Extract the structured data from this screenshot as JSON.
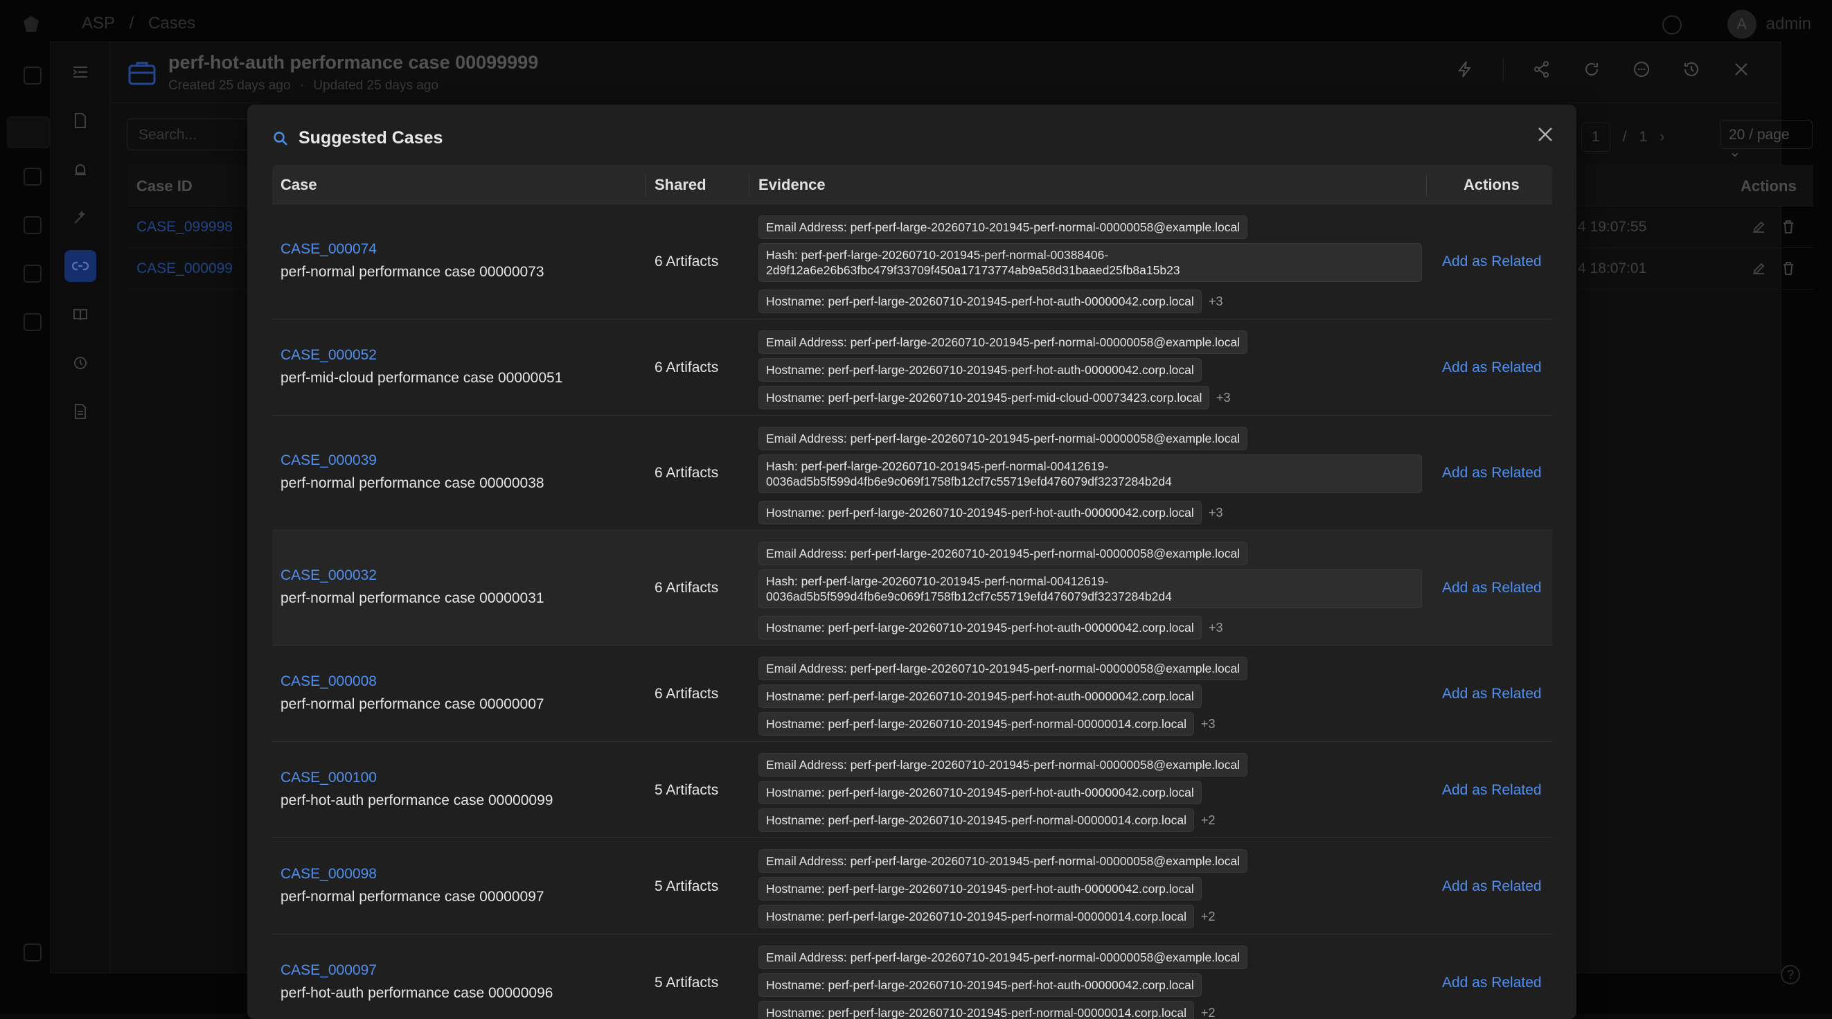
{
  "app": {
    "breadcrumb": [
      "ASP",
      "/",
      "Cases"
    ],
    "user": {
      "avatar": "A",
      "name": "admin"
    }
  },
  "drawer": {
    "title": "perf-hot-auth performance case 00099999",
    "created": "Created 25 days ago",
    "updated": "Updated 25 days ago",
    "meta_sep": "·",
    "search_placeholder": "Search...",
    "pager": {
      "current": "1",
      "sep": "/",
      "total": "1",
      "page_size": "20 / page"
    },
    "table": {
      "col_case_id": "Case ID",
      "col_actions": "Actions",
      "rows": [
        {
          "id": "CASE_099998",
          "time": "4 19:07:55"
        },
        {
          "id": "CASE_000099",
          "time": "4 18:07:01"
        }
      ]
    }
  },
  "modal": {
    "title": "Suggested Cases",
    "columns": {
      "case": "Case",
      "shared": "Shared",
      "evidence": "Evidence",
      "actions": "Actions"
    },
    "action_label": "Add as Related",
    "rows": [
      {
        "id": "CASE_000074",
        "name": "perf-normal performance case 00000073",
        "shared": "6 Artifacts",
        "evidence": [
          "Email Address: perf-perf-large-20260710-201945-perf-normal-00000058@example.local",
          "Hash: perf-perf-large-20260710-201945-perf-normal-00388406-2d9f12a6e26b63fbc479f33709f450a17173774ab9a58d31baaed25fb8a15b23",
          "Hostname: perf-perf-large-20260710-201945-perf-hot-auth-00000042.corp.local"
        ],
        "more": "+3"
      },
      {
        "id": "CASE_000052",
        "name": "perf-mid-cloud performance case 00000051",
        "shared": "6 Artifacts",
        "evidence": [
          "Email Address: perf-perf-large-20260710-201945-perf-normal-00000058@example.local",
          "Hostname: perf-perf-large-20260710-201945-perf-hot-auth-00000042.corp.local",
          "Hostname: perf-perf-large-20260710-201945-perf-mid-cloud-00073423.corp.local"
        ],
        "more": "+3"
      },
      {
        "id": "CASE_000039",
        "name": "perf-normal performance case 00000038",
        "shared": "6 Artifacts",
        "evidence": [
          "Email Address: perf-perf-large-20260710-201945-perf-normal-00000058@example.local",
          "Hash: perf-perf-large-20260710-201945-perf-normal-00412619-0036ad5b5f599d4fb6e9c069f1758fb12cf7c55719efd476079df3237284b2d4",
          "Hostname: perf-perf-large-20260710-201945-perf-hot-auth-00000042.corp.local"
        ],
        "more": "+3"
      },
      {
        "id": "CASE_000032",
        "name": "perf-normal performance case 00000031",
        "shared": "6 Artifacts",
        "evidence": [
          "Email Address: perf-perf-large-20260710-201945-perf-normal-00000058@example.local",
          "Hash: perf-perf-large-20260710-201945-perf-normal-00412619-0036ad5b5f599d4fb6e9c069f1758fb12cf7c55719efd476079df3237284b2d4",
          "Hostname: perf-perf-large-20260710-201945-perf-hot-auth-00000042.corp.local"
        ],
        "more": "+3"
      },
      {
        "id": "CASE_000008",
        "name": "perf-normal performance case 00000007",
        "shared": "6 Artifacts",
        "evidence": [
          "Email Address: perf-perf-large-20260710-201945-perf-normal-00000058@example.local",
          "Hostname: perf-perf-large-20260710-201945-perf-hot-auth-00000042.corp.local",
          "Hostname: perf-perf-large-20260710-201945-perf-normal-00000014.corp.local"
        ],
        "more": "+3"
      },
      {
        "id": "CASE_000100",
        "name": "perf-hot-auth performance case 00000099",
        "shared": "5 Artifacts",
        "evidence": [
          "Email Address: perf-perf-large-20260710-201945-perf-normal-00000058@example.local",
          "Hostname: perf-perf-large-20260710-201945-perf-hot-auth-00000042.corp.local",
          "Hostname: perf-perf-large-20260710-201945-perf-normal-00000014.corp.local"
        ],
        "more": "+2"
      },
      {
        "id": "CASE_000098",
        "name": "perf-normal performance case 00000097",
        "shared": "5 Artifacts",
        "evidence": [
          "Email Address: perf-perf-large-20260710-201945-perf-normal-00000058@example.local",
          "Hostname: perf-perf-large-20260710-201945-perf-hot-auth-00000042.corp.local",
          "Hostname: perf-perf-large-20260710-201945-perf-normal-00000014.corp.local"
        ],
        "more": "+2"
      },
      {
        "id": "CASE_000097",
        "name": "perf-hot-auth performance case 00000096",
        "shared": "5 Artifacts",
        "evidence": [
          "Email Address: perf-perf-large-20260710-201945-perf-normal-00000058@example.local",
          "Hostname: perf-perf-large-20260710-201945-perf-hot-auth-00000042.corp.local",
          "Hostname: perf-perf-large-20260710-201945-perf-normal-00000014.corp.local"
        ],
        "more": "+2"
      }
    ]
  }
}
